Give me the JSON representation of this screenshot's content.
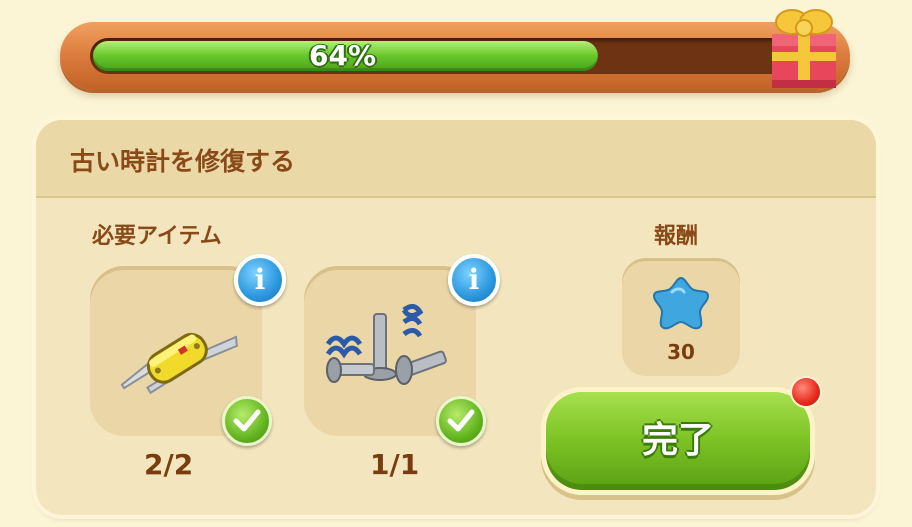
{
  "progress": {
    "value": 0.64,
    "label": "64%"
  },
  "quest": {
    "title": "古い時計を修復する"
  },
  "required_items": {
    "label": "必要アイテム",
    "items": [
      {
        "name": "swiss-army-knife",
        "count": "2/2",
        "completed": true
      },
      {
        "name": "screws-and-springs",
        "count": "1/1",
        "completed": true
      }
    ]
  },
  "reward": {
    "label": "報酬",
    "currency_icon": "blue-star-icon",
    "amount": "30"
  },
  "complete_button": {
    "label": "完了",
    "has_notification": true
  },
  "colors": {
    "progress_fill": "#6cc92e",
    "title_text": "#8a4a18",
    "button_green": "#7cc224",
    "info_blue": "#2a97de"
  }
}
